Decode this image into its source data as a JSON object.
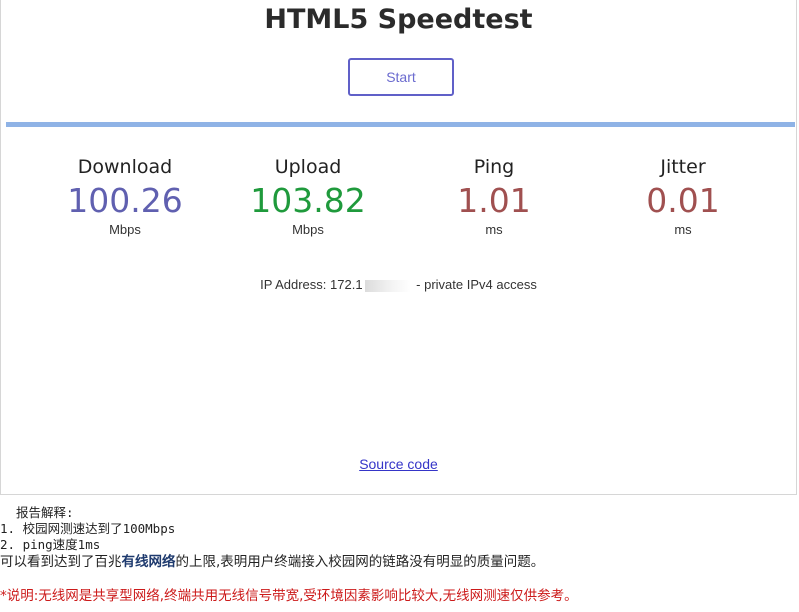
{
  "header": {
    "title": "HTML5 Speedtest",
    "start_label": "Start"
  },
  "progress": {
    "percent": 100,
    "color": "#8fb3e6"
  },
  "metrics": [
    {
      "label": "Download",
      "value": "100.26",
      "unit": "Mbps",
      "color": "#6060b0"
    },
    {
      "label": "Upload",
      "value": "103.82",
      "unit": "Mbps",
      "color": "#1f9a3c"
    },
    {
      "label": "Ping",
      "value": "1.01",
      "unit": "ms",
      "color": "#a05050"
    },
    {
      "label": "Jitter",
      "value": "0.01",
      "unit": "ms",
      "color": "#a05050"
    }
  ],
  "ip": {
    "prefix": "IP Address: 172.1",
    "suffix": " - private IPv4 access"
  },
  "footer": {
    "source_label": "Source code"
  },
  "report": {
    "heading": "报告解释:",
    "item1": "1. 校园网测速达到了100Mbps",
    "item2": "2. ping速度1ms",
    "conclusion_pre": "可以看到达到了百兆",
    "conclusion_strong": "有线网络",
    "conclusion_post": "的上限,表明用户终端接入校园网的链路没有明显的质量问题。",
    "notice": "*说明:无线网是共享型网络,终端共用无线信号带宽,受环境因素影响比较大,无线网测速仅供参考。"
  }
}
